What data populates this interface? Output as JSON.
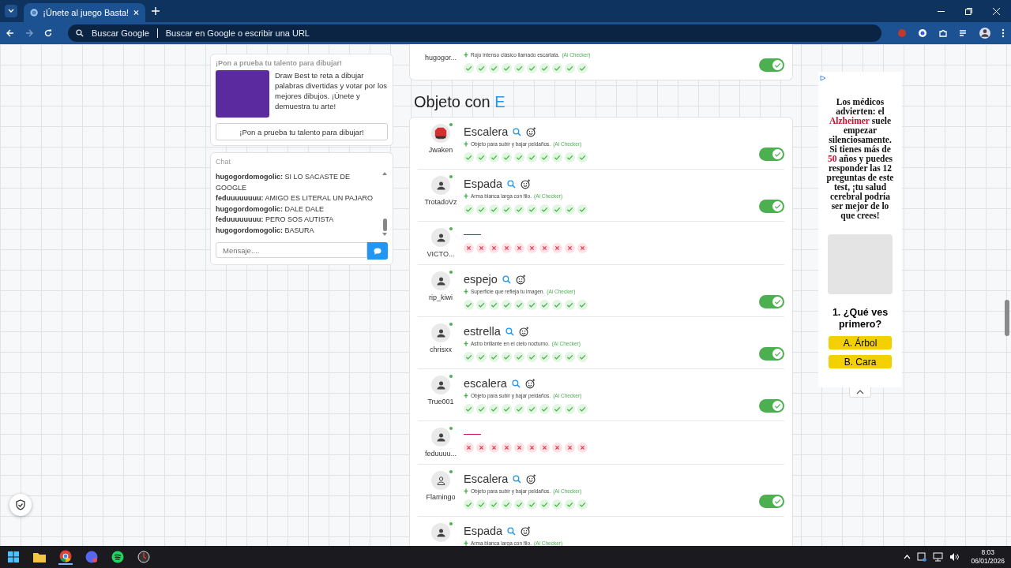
{
  "browser": {
    "tab_title": "¡Únete al juego Basta!",
    "omnibox": {
      "engine": "Buscar Google",
      "placeholder": "Buscar en Google o escribir una URL"
    }
  },
  "promo": {
    "heading": "¡Pon a prueba tu talento para dibujar!",
    "description": "Draw Best te reta a dibujar palabras divertidas y votar por los mejores dibujos. ¡Únete y demuestra tu arte!",
    "button": "¡Pon a prueba tu talento para dibujar!"
  },
  "chat": {
    "title": "Chat",
    "messages": [
      {
        "user": "hugogordomogolic:",
        "text": "SI LO SACASTE DE GOOGLE"
      },
      {
        "user": "feduuuuuuuu:",
        "text": "AMIGO ES LITERAL UN PAJARO"
      },
      {
        "user": "hugogordomogolic:",
        "text": "DALE DALE"
      },
      {
        "user": "feduuuuuuuu:",
        "text": "PERO SOS AUTISTA"
      },
      {
        "user": "hugogordomogolic:",
        "text": "BASURA"
      }
    ],
    "input": {
      "placeholder": "Mensaje...."
    }
  },
  "top_card": {
    "entries": [
      {
        "kind": "word",
        "user": "hugogor...",
        "description": "Rojo intenso clásico llamado escarlata.",
        "checker": "(Ai Checker)",
        "votes": [
          {
            "valid": true
          },
          {
            "valid": true
          },
          {
            "valid": true
          },
          {
            "valid": true
          },
          {
            "valid": true
          },
          {
            "valid": true
          },
          {
            "valid": true
          },
          {
            "valid": true
          },
          {
            "valid": true
          },
          {
            "valid": true
          }
        ],
        "accepted": true
      }
    ]
  },
  "section": {
    "title": "Objeto con",
    "letter": "E",
    "entries": [
      {
        "kind": "word",
        "user": "Jwaken",
        "avatar": {
          "kind": "stop"
        },
        "word": "Escalera",
        "description": "Objeto para subir y bajar peldaños.",
        "checker": "(Ai Checker)",
        "votes": [
          {
            "valid": true
          },
          {
            "valid": true
          },
          {
            "valid": true
          },
          {
            "valid": true
          },
          {
            "valid": true
          },
          {
            "valid": true
          },
          {
            "valid": true
          },
          {
            "valid": true
          },
          {
            "valid": true
          },
          {
            "valid": true
          }
        ],
        "accepted": true
      },
      {
        "kind": "word",
        "user": "TrotadoVz",
        "avatar": {
          "kind": "default"
        },
        "word": "Espada",
        "description": "Arma blanca larga con filo.",
        "checker": "(Ai Checker)",
        "votes": [
          {
            "valid": true
          },
          {
            "valid": true
          },
          {
            "valid": true
          },
          {
            "valid": true
          },
          {
            "valid": true
          },
          {
            "valid": true
          },
          {
            "valid": true
          },
          {
            "valid": true
          },
          {
            "valid": true
          },
          {
            "valid": true
          }
        ],
        "accepted": true
      },
      {
        "kind": "blank",
        "user": "VICTO...",
        "avatar": {
          "kind": "default"
        },
        "votes": [
          {
            "valid": false
          },
          {
            "valid": false
          },
          {
            "valid": false
          },
          {
            "valid": false
          },
          {
            "valid": false
          },
          {
            "valid": false
          },
          {
            "valid": false
          },
          {
            "valid": false
          },
          {
            "valid": false
          },
          {
            "valid": false
          }
        ]
      },
      {
        "kind": "word",
        "user": "rip_kiwi",
        "avatar": {
          "kind": "default"
        },
        "word": "espejo",
        "description": "Superficie que refleja tu imagen.",
        "checker": "(Ai Checker)",
        "votes": [
          {
            "valid": true
          },
          {
            "valid": true
          },
          {
            "valid": true
          },
          {
            "valid": true
          },
          {
            "valid": true
          },
          {
            "valid": true
          },
          {
            "valid": true
          },
          {
            "valid": true
          },
          {
            "valid": true
          },
          {
            "valid": true
          }
        ],
        "accepted": true
      },
      {
        "kind": "word",
        "user": "chrisxx",
        "avatar": {
          "kind": "default"
        },
        "word": "estrella",
        "description": "Astro brillante en el cielo nocturno.",
        "checker": "(Ai Checker)",
        "votes": [
          {
            "valid": true
          },
          {
            "valid": true
          },
          {
            "valid": true
          },
          {
            "valid": true
          },
          {
            "valid": true
          },
          {
            "valid": true
          },
          {
            "valid": true
          },
          {
            "valid": true
          },
          {
            "valid": true
          },
          {
            "valid": true
          }
        ],
        "accepted": true
      },
      {
        "kind": "word",
        "user": "True001",
        "avatar": {
          "kind": "default"
        },
        "word": "escalera",
        "description": "Objeto para subir y bajar peldaños.",
        "checker": "(Ai Checker)",
        "votes": [
          {
            "valid": true
          },
          {
            "valid": true
          },
          {
            "valid": true
          },
          {
            "valid": true
          },
          {
            "valid": true
          },
          {
            "valid": true
          },
          {
            "valid": true
          },
          {
            "valid": true
          },
          {
            "valid": true
          },
          {
            "valid": true
          }
        ],
        "accepted": true
      },
      {
        "kind": "blank",
        "user": "feduuuu...",
        "avatar": {
          "kind": "default"
        },
        "votes": [
          {
            "valid": false
          },
          {
            "valid": false
          },
          {
            "valid": false
          },
          {
            "valid": false
          },
          {
            "valid": false
          },
          {
            "valid": false
          },
          {
            "valid": false
          },
          {
            "valid": false
          },
          {
            "valid": false
          },
          {
            "valid": false
          }
        ]
      },
      {
        "kind": "word",
        "user": "Flamingo",
        "avatar": {
          "kind": "outline"
        },
        "word": "Escalera",
        "description": "Objeto para subir y bajar peldaños.",
        "checker": "(Ai Checker)",
        "votes": [
          {
            "valid": true
          },
          {
            "valid": true
          },
          {
            "valid": true
          },
          {
            "valid": true
          },
          {
            "valid": true
          },
          {
            "valid": true
          },
          {
            "valid": true
          },
          {
            "valid": true
          },
          {
            "valid": true
          },
          {
            "valid": true
          }
        ],
        "accepted": true
      },
      {
        "kind": "word",
        "avatar": {
          "kind": "default"
        },
        "word": "Espada",
        "description": "Arma blanca larga con filo.",
        "checker": "(Ai Checker)"
      }
    ]
  },
  "ad": {
    "text": "Los médicos advierten: el **Alzheimer** suele empezar silenciosamente. Si tienes más de **50** años y puedes responder las 12 preguntas de este test, ¡tu salud cerebral podría ser mejor de lo que crees!",
    "question": "1. ¿Qué ves primero?",
    "options": [
      "A. Árbol",
      "B. Cara"
    ]
  },
  "taskbar": {
    "time": "8:03",
    "date": "06/01/2026"
  }
}
